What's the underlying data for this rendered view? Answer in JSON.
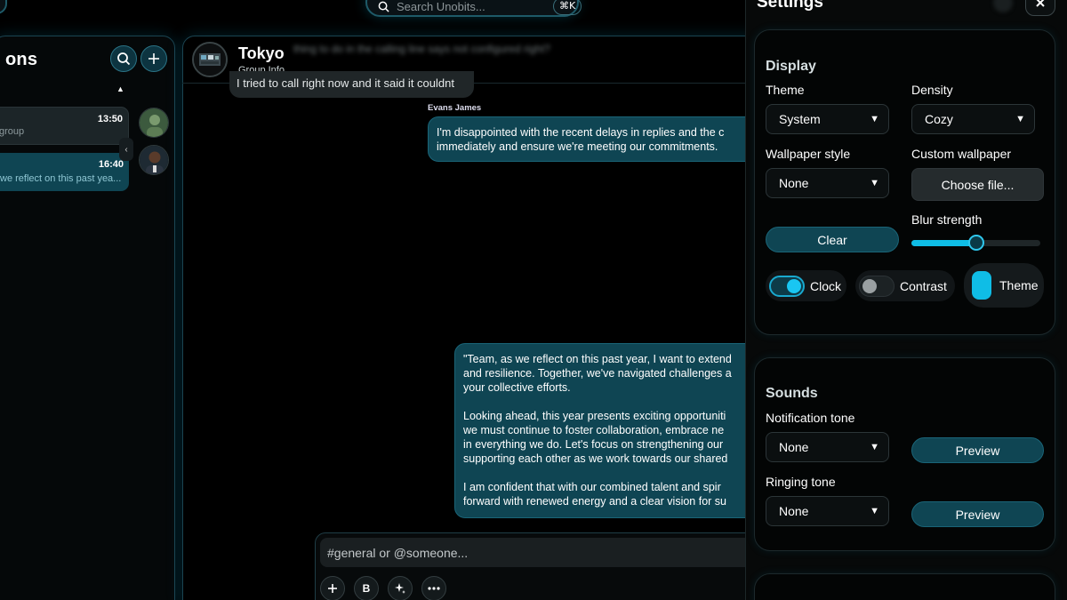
{
  "search": {
    "placeholder": "Search Unobits...",
    "shortcut": "⌘K"
  },
  "sidebar": {
    "title": "ons",
    "conversations": [
      {
        "time": "13:50",
        "preview": "group"
      },
      {
        "time": "16:40",
        "preview": "we reflect on this past yea..."
      }
    ]
  },
  "chat": {
    "group_name": "Tokyo",
    "group_info": "Group Info",
    "blurred_preview": "thing to do in the calling line says not configured right?",
    "messages": [
      {
        "text": "I tried to call right now and it said it couldnt"
      },
      {
        "sender": "Evans James",
        "lines": [
          "I'm disappointed with the recent delays in replies and the c",
          "immediately and ensure we're meeting our commitments."
        ]
      },
      {
        "paragraphs": [
          [
            "\"Team, as we reflect on this past year, I want to extend",
            "and resilience. Together, we've navigated challenges a",
            "your collective efforts."
          ],
          [
            "Looking ahead, this year presents exciting opportuniti",
            "we must continue to foster collaboration, embrace ne",
            "in everything we do. Let's focus on strengthening our",
            "supporting each other as we work towards our shared"
          ],
          [
            "I am confident that with our combined talent and spir",
            "forward with renewed energy and a clear vision for su"
          ]
        ]
      }
    ],
    "composer_placeholder": "#general or @someone...",
    "composer_tools": {
      "bold": "B"
    }
  },
  "settings": {
    "title": "Settings",
    "display": {
      "heading": "Display",
      "theme_label": "Theme",
      "theme_value": "System",
      "density_label": "Density",
      "density_value": "Cozy",
      "wallpaper_style_label": "Wallpaper style",
      "wallpaper_style_value": "None",
      "custom_wallpaper_label": "Custom wallpaper",
      "choose_file": "Choose file...",
      "clear": "Clear",
      "blur_label": "Blur strength",
      "blur_value": 0.5,
      "toggles": {
        "clock": "Clock",
        "contrast": "Contrast",
        "theme": "Theme"
      }
    },
    "sounds": {
      "heading": "Sounds",
      "notification_label": "Notification tone",
      "notification_value": "None",
      "ringing_label": "Ringing tone",
      "ringing_value": "None",
      "preview": "Preview"
    }
  },
  "colors": {
    "accent": "#0fbde6",
    "teal_bubble": "#0f4553",
    "border_glow": "#1b4451"
  }
}
